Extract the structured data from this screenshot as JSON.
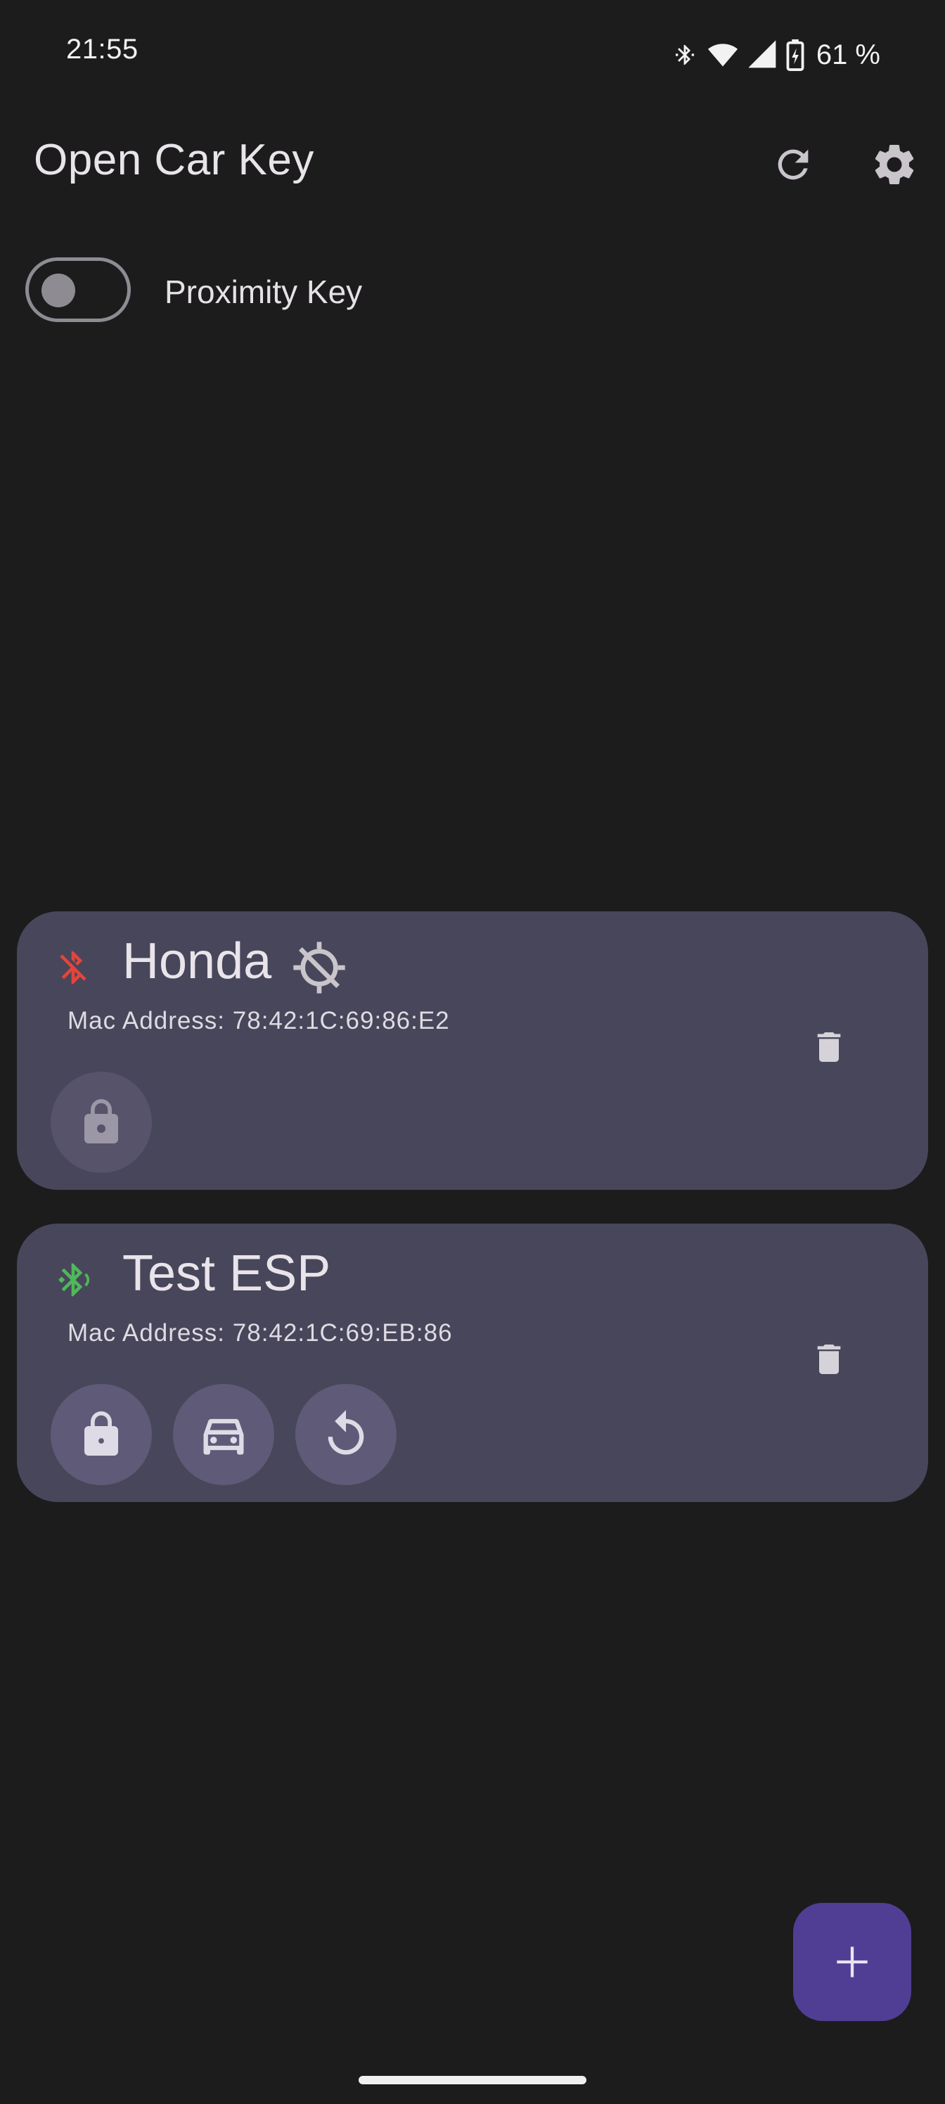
{
  "status_bar": {
    "time": "21:55",
    "battery_percent": "61 %",
    "icons": [
      "bluetooth-icon",
      "wifi-icon",
      "cell-signal-icon",
      "battery-charging-icon"
    ]
  },
  "app_bar": {
    "title": "Open Car Key",
    "actions": [
      "refresh-icon",
      "settings-gear-icon"
    ]
  },
  "proximity": {
    "label": "Proximity Key",
    "enabled": false
  },
  "keys": [
    {
      "name": "Honda",
      "mac_address": "Mac Address: 78:42:1C:69:86:E2",
      "bluetooth_status": "disconnected",
      "bluetooth_icon": "bluetooth-disabled-icon",
      "bluetooth_color": "#e2453c",
      "location_icon": "location-disabled-icon",
      "actions": [
        "lock-icon"
      ],
      "actions_enabled": false
    },
    {
      "name": "Test ESP",
      "mac_address": "Mac Address: 78:42:1C:69:EB:86",
      "bluetooth_status": "connected",
      "bluetooth_icon": "bluetooth-connected-icon",
      "bluetooth_color": "#4fb85a",
      "actions": [
        "lock-icon",
        "car-icon",
        "replay-icon"
      ],
      "actions_enabled": true
    }
  ],
  "fab": {
    "icon": "add-icon",
    "color": "#4f3e94"
  },
  "colors": {
    "background": "#1c1c1d",
    "card": "#48465a",
    "action_button": "#5f5a77"
  }
}
